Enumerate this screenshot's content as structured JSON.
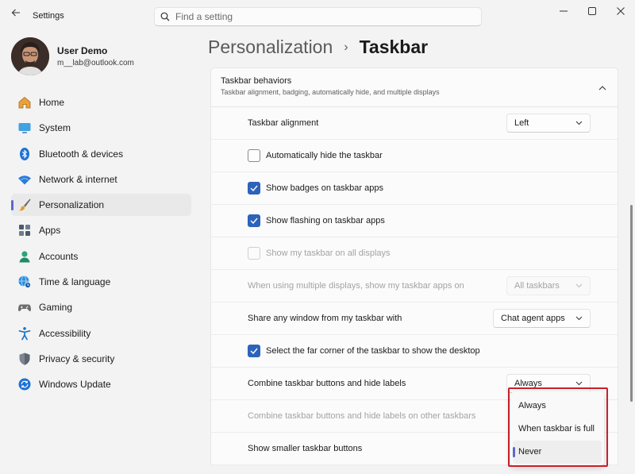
{
  "app": {
    "title": "Settings"
  },
  "search": {
    "placeholder": "Find a setting"
  },
  "profile": {
    "name": "User Demo",
    "email": "m__lab@outlook.com"
  },
  "nav": [
    {
      "label": "Home",
      "icon": "home-icon"
    },
    {
      "label": "System",
      "icon": "monitor-icon"
    },
    {
      "label": "Bluetooth & devices",
      "icon": "bluetooth-icon"
    },
    {
      "label": "Network & internet",
      "icon": "wifi-icon"
    },
    {
      "label": "Personalization",
      "icon": "brush-icon",
      "active": true
    },
    {
      "label": "Apps",
      "icon": "apps-icon"
    },
    {
      "label": "Accounts",
      "icon": "person-icon"
    },
    {
      "label": "Time & language",
      "icon": "globe-clock-icon"
    },
    {
      "label": "Gaming",
      "icon": "controller-icon"
    },
    {
      "label": "Accessibility",
      "icon": "accessibility-icon"
    },
    {
      "label": "Privacy & security",
      "icon": "shield-icon"
    },
    {
      "label": "Windows Update",
      "icon": "update-icon"
    }
  ],
  "breadcrumb": {
    "parent": "Personalization",
    "separator": "›",
    "current": "Taskbar"
  },
  "section": {
    "title": "Taskbar behaviors",
    "subtitle": "Taskbar alignment, badging, automatically hide, and multiple displays"
  },
  "rows": {
    "alignment": {
      "label": "Taskbar alignment",
      "value": "Left"
    },
    "auto_hide": {
      "label": "Automatically hide the taskbar",
      "checked": false
    },
    "badges": {
      "label": "Show badges on taskbar apps",
      "checked": true
    },
    "flashing": {
      "label": "Show flashing on taskbar apps",
      "checked": true
    },
    "all_displays": {
      "label": "Show my taskbar on all displays",
      "checked": false,
      "disabled": true
    },
    "multi_display_apps": {
      "label": "When using multiple displays, show my taskbar apps on",
      "value": "All taskbars",
      "disabled": true
    },
    "share_window": {
      "label": "Share any window from my taskbar with",
      "value": "Chat agent apps"
    },
    "far_corner": {
      "label": "Select the far corner of the taskbar to show the desktop",
      "checked": true
    },
    "combine": {
      "label": "Combine taskbar buttons and hide labels",
      "value": "Always"
    },
    "combine_other": {
      "label": "Combine taskbar buttons and hide labels on other taskbars",
      "disabled": true
    },
    "smaller": {
      "label": "Show smaller taskbar buttons"
    }
  },
  "menu": {
    "options": [
      "Always",
      "When taskbar is full",
      "Never"
    ],
    "selected": "Never"
  },
  "colors": {
    "accent": "#2d63b9",
    "nav_indicator": "#5b6ac9",
    "highlight": "#c8202a"
  }
}
